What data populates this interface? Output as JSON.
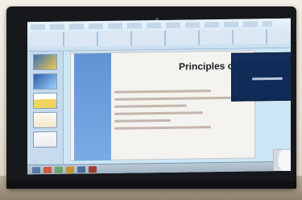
{
  "photo": {
    "slide": {
      "title": "Principles of CM"
    }
  }
}
